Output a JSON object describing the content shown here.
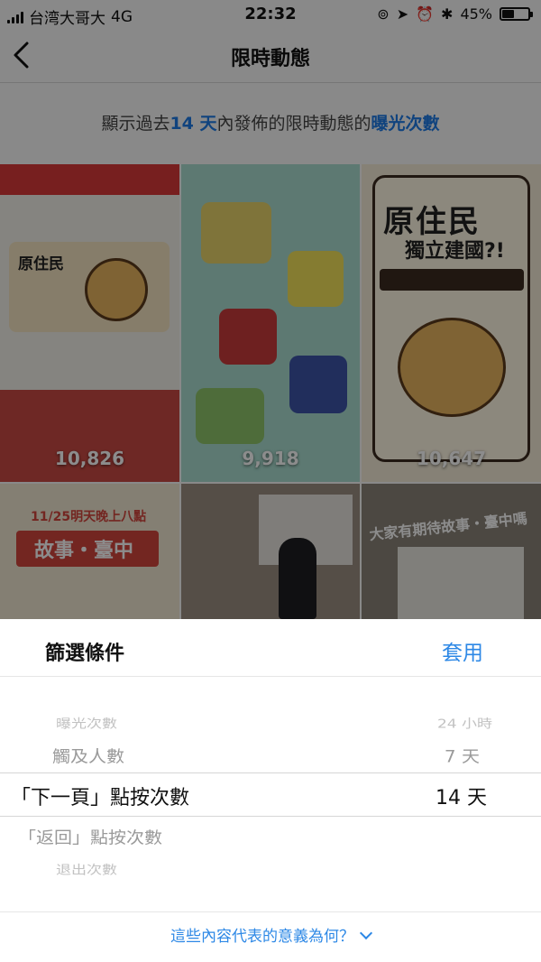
{
  "status_bar": {
    "carrier": "台湾大哥大",
    "network": "4G",
    "time": "22:32",
    "battery": "45%"
  },
  "nav": {
    "title": "限時動態"
  },
  "info": {
    "prefix": "顯示過去",
    "days": "14 天",
    "middle": "內發佈的限時動態的",
    "metric": "曝光次數"
  },
  "stories": [
    {
      "views": "10,826"
    },
    {
      "views": "9,918"
    },
    {
      "views": "10,647"
    },
    {
      "views": ""
    },
    {
      "views": ""
    },
    {
      "views": ""
    }
  ],
  "story_text": {
    "t1_card": "原住民",
    "t3_title": "原住民",
    "t3_sub": "獨立建國?!",
    "t4_line1": "11/25明天晚上八點",
    "t4_big": "故事・臺中",
    "t6_caption": "大家有期待故事・臺中嗎"
  },
  "sheet": {
    "title": "篩選條件",
    "apply_label": "套用",
    "metrics": [
      "曝光次數",
      "觸及人數",
      "「下一頁」點按次數",
      "「返回」點按次數",
      "退出次數"
    ],
    "periods": [
      "24 小時",
      "7 天",
      "14 天"
    ],
    "footer_link": "這些內容代表的意義為何？"
  },
  "colors": {
    "accent_blue": "#2d88e6",
    "info_blue": "#1e7be6"
  }
}
